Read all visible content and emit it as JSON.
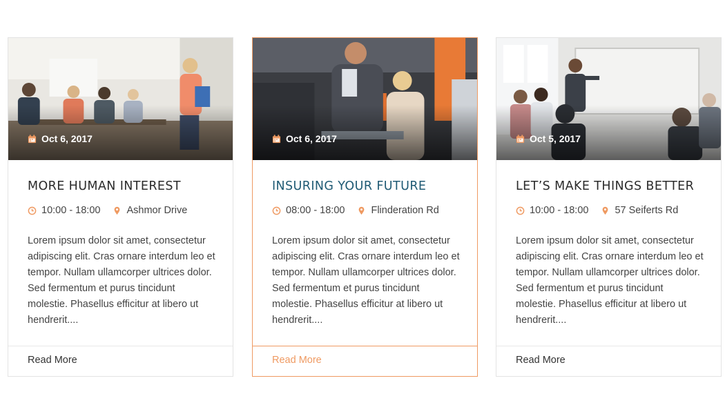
{
  "colors": {
    "accent": "#ef9a62",
    "title_active": "#1f5a74",
    "text": "#444444",
    "border": "#e3e3e3"
  },
  "icons": {
    "date": "calendar-icon",
    "time": "clock-icon",
    "location": "map-pin-icon"
  },
  "cards": [
    {
      "date": "Oct 6, 2017",
      "title": "MORE HUMAN INTEREST",
      "time": "10:00 - 18:00",
      "location": "Ashmor Drive",
      "body": "Lorem ipsum dolor sit amet, consectetur adipiscing elit. Cras ornare interdum leo et tempor. Nullam ullamcorper ultrices dolor. Sed fermentum et purus tincidunt molestie. Phasellus efficitur at libero ut hendrerit....",
      "read_more": "Read More"
    },
    {
      "date": "Oct 6, 2017",
      "title": "INSURING YOUR FUTURE",
      "time": "08:00 - 18:00",
      "location": "Flinderation Rd",
      "body": "Lorem ipsum dolor sit amet, consectetur adipiscing elit. Cras ornare interdum leo et tempor. Nullam ullamcorper ultrices dolor. Sed fermentum et purus tincidunt molestie. Phasellus efficitur at libero ut hendrerit....",
      "read_more": "Read More"
    },
    {
      "date": "Oct 5, 2017",
      "title": "LET’S MAKE THINGS BETTER",
      "time": "10:00 - 18:00",
      "location": "57 Seiferts Rd",
      "body": "Lorem ipsum dolor sit amet, consectetur adipiscing elit. Cras ornare interdum leo et tempor. Nullam ullamcorper ultrices dolor. Sed fermentum et purus tincidunt molestie. Phasellus efficitur at libero ut hendrerit....",
      "read_more": "Read More"
    }
  ]
}
